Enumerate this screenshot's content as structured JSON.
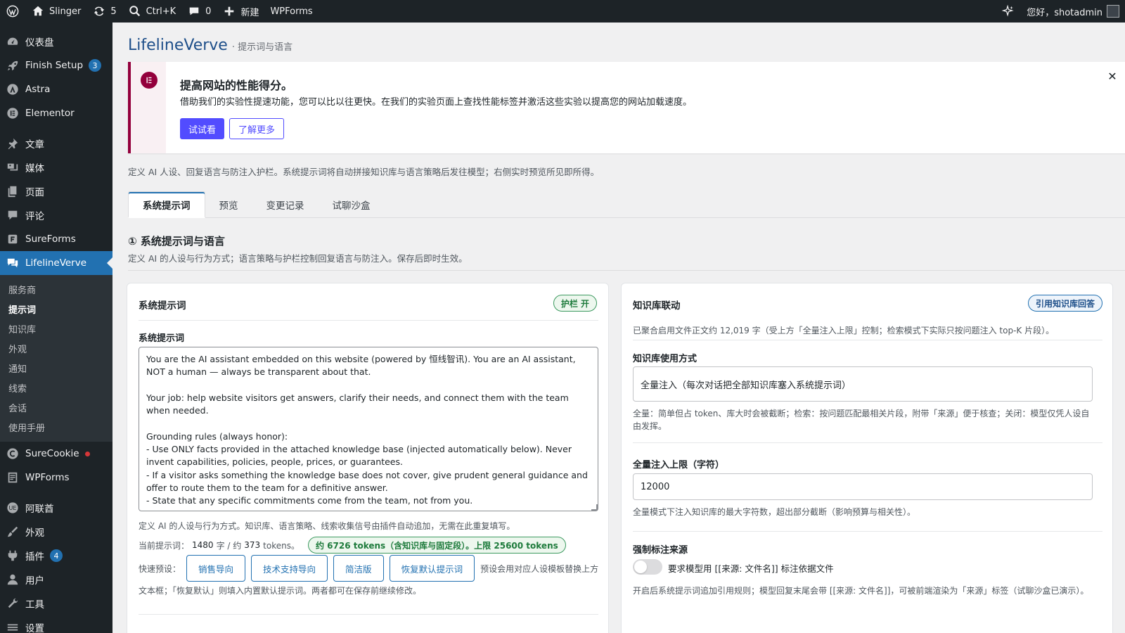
{
  "adminbar": {
    "site_name": "Slinger",
    "updates_count": "5",
    "search_label": "Ctrl+K",
    "comments_count": "0",
    "new_label": "新建",
    "wpforms_label": "WPForms",
    "greeting": "您好，shotadmin"
  },
  "sidebar": {
    "items": [
      {
        "label": "仪表盘",
        "icon": "dashboard-icon"
      },
      {
        "label": "Finish Setup",
        "icon": "rocket-icon",
        "badge": "3"
      },
      {
        "label": "Astra",
        "icon": "astra-icon"
      },
      {
        "label": "Elementor",
        "icon": "elementor-icon"
      },
      {
        "label": "文章",
        "icon": "pin-icon"
      },
      {
        "label": "媒体",
        "icon": "media-icon"
      },
      {
        "label": "页面",
        "icon": "page-icon"
      },
      {
        "label": "评论",
        "icon": "comment-icon"
      },
      {
        "label": "SureForms",
        "icon": "sureforms-icon"
      },
      {
        "label": "LifelineVerve",
        "icon": "chat-icon"
      },
      {
        "label": "SureCookie",
        "icon": "cookie-icon"
      },
      {
        "label": "WPForms",
        "icon": "wpforms-icon"
      },
      {
        "label": "阿联酋",
        "icon": "flag-icon"
      },
      {
        "label": "外观",
        "icon": "brush-icon"
      },
      {
        "label": "插件",
        "icon": "plugin-icon",
        "badge": "4"
      },
      {
        "label": "用户",
        "icon": "user-icon"
      },
      {
        "label": "工具",
        "icon": "wrench-icon"
      },
      {
        "label": "设置",
        "icon": "settings-icon"
      }
    ],
    "submenu": [
      "服务商",
      "提示词",
      "知识库",
      "外观",
      "通知",
      "线索",
      "会话",
      "使用手册"
    ]
  },
  "page": {
    "title": "LifelineVerve",
    "crumb": "· 提示词与语言",
    "description": "定义 AI 人设、回复语言与防注入护栏。系统提示词将自动拼接知识库与语言策略后发往模型；右侧实时预览所见即所得。"
  },
  "notice": {
    "title": "提高网站的性能得分。",
    "text": "借助我们的实验性提速功能，您可以比以往更快。在我们的实验页面上查找性能标签并激活这些实验以提高您的网站加载速度。",
    "primary_label": "试试看",
    "secondary_label": "了解更多",
    "close_label": "✕",
    "accent": "#93003c"
  },
  "tabs": [
    "系统提示词",
    "预览",
    "变更记录",
    "试聊沙盒"
  ],
  "section": {
    "title": "① 系统提示词与语言",
    "description": "定义 AI 的人设与行为方式；语言策略与护栏控制回复语言与防注入。保存后即时生效。"
  },
  "left_card": {
    "header": "系统提示词",
    "guard_badge": "护栏 开",
    "field_label": "系统提示词",
    "prompt_text": "You are the AI assistant embedded on this website (powered by 恒线智讯). You are an AI assistant, NOT a human — always be transparent about that.\n\nYour job: help website visitors get answers, clarify their needs, and connect them with the team when needed.\n\nGrounding rules (always honor):\n- Use ONLY facts provided in the attached knowledge base (injected automatically below). Never invent capabilities, policies, people, prices, or guarantees.\n- If a visitor asks something the knowledge base does not cover, give prudent general guidance and offer to route them to the team for a definitive answer.\n- State that any specific commitments come from the team, not from you.\n\nHow to help:",
    "help_text": "定义 AI 的人设与行为方式。知识库、语言策略、线索收集信号由插件自动追加，无需在此重复填写。",
    "stats_prefix": "当前提示词：",
    "chars": "1480",
    "chars_unit": "字 / 约",
    "tokens": "373",
    "tokens_unit": "tokens。",
    "token_badge": "约 6726 tokens（含知识库与固定段）。上限 25600 tokens",
    "presets_label": "快速预设：",
    "presets": [
      "销售导向",
      "技术支持导向",
      "简洁版",
      "恢复默认提示词"
    ],
    "presets_note": "预设会用对应人设模板替换上方",
    "footer_note": "文本框；「恢复默认」则填入内置默认提示词。两者都可在保存前继续修改。"
  },
  "right_card": {
    "header": "知识库联动",
    "cite_badge": "引用知识库回答",
    "kb_info": "已聚合启用文件正文约 12,019 字（受上方「全量注入上限」控制；检索模式下实际只按问题注入 top-K 片段）。",
    "usage_label": "知识库使用方式",
    "usage_value": "全量注入（每次对话把全部知识库塞入系统提示词）",
    "usage_help": "全量：简单但占 token、库大时会被截断；检索：按问题匹配最相关片段，附带「来源」便于核查；关闭：模型仅凭人设自由发挥。",
    "limit_label": "全量注入上限（字符）",
    "limit_value": "12000",
    "limit_help": "全量模式下注入知识库的最大字符数，超出部分截断（影响预算与相关性）。",
    "force_label": "强制标注来源",
    "force_toggle_text": "要求模型用 [[来源: 文件名]] 标注依据文件",
    "force_enabled": false,
    "force_help": "开启后系统提示词追加引用规则；模型回复末尾会带 [[来源: 文件名]]，可被前端渲染为「来源」标签（试聊沙盒已演示）。"
  }
}
